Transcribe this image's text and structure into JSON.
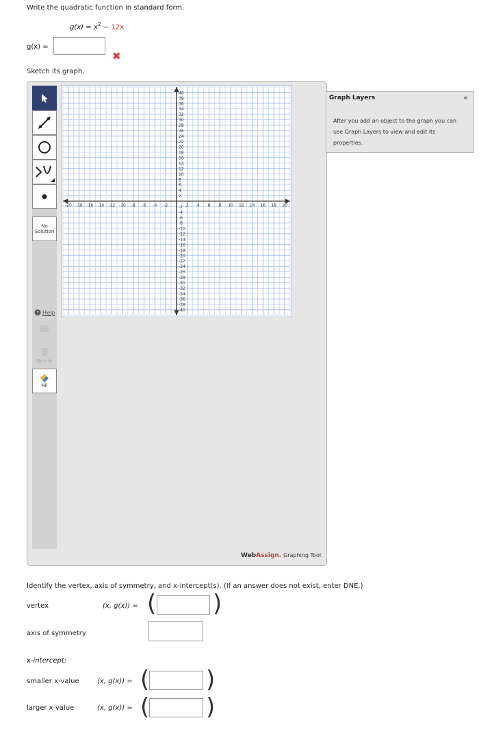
{
  "prompt": "Write the quadratic function in standard form.",
  "function": {
    "name": "g(x)",
    "equals": "=",
    "rhs_a": "x",
    "exp": "2",
    "rhs_b": "−",
    "rhs_c": "12x"
  },
  "answer_label": "g(x) =",
  "answer_value": "",
  "wrong_mark": "✖",
  "sketch_prompt": "Sketch its graph.",
  "toolbar": {
    "no_solution_line1": "No",
    "no_solution_line2": "Solution",
    "help": "Help",
    "delete_faded": "Delete",
    "fill": "Fill"
  },
  "graph_layers": {
    "title": "Graph Layers",
    "collapse": "«",
    "hint": "After you add an object to the graph you can use Graph Layers to view and edit its properties."
  },
  "brand": {
    "web": "Web",
    "assign": "Assign.",
    "tool": "Graphing Tool",
    "web_color": "#333333",
    "assign_color": "#c0392b"
  },
  "identify_prompt": "Identify the vertex, axis of symmetry, and x-intercept(s). (If an answer does not exist, enter DNE.)",
  "vertex": {
    "label": "vertex",
    "pair": "(x, g(x)) =",
    "value": ""
  },
  "axis": {
    "label": "axis of symmetry",
    "value": ""
  },
  "xintercept": {
    "label": "x-intercept:"
  },
  "smaller": {
    "label": "smaller x-value",
    "pair": "(x, g(x)) =",
    "value": ""
  },
  "larger": {
    "label": "larger x-value",
    "pair": "(x, g(x)) =",
    "value": ""
  },
  "chart_data": {
    "type": "scatter",
    "title": "",
    "xlim": [
      -21,
      21
    ],
    "ylim": [
      -42,
      42
    ],
    "x_ticks": [
      -20,
      -18,
      -16,
      -14,
      -12,
      -10,
      -8,
      -6,
      -4,
      -2,
      2,
      4,
      6,
      8,
      10,
      12,
      14,
      16,
      18,
      20
    ],
    "y_ticks": [
      40,
      38,
      36,
      34,
      32,
      30,
      28,
      26,
      24,
      22,
      20,
      18,
      16,
      14,
      12,
      10,
      8,
      6,
      4,
      2,
      -2,
      -4,
      -6,
      -8,
      -10,
      -12,
      -14,
      -16,
      -18,
      -20,
      -22,
      -24,
      -26,
      -28,
      -30,
      -32,
      -34,
      -36,
      -38,
      -40
    ],
    "grid": true,
    "series": []
  }
}
